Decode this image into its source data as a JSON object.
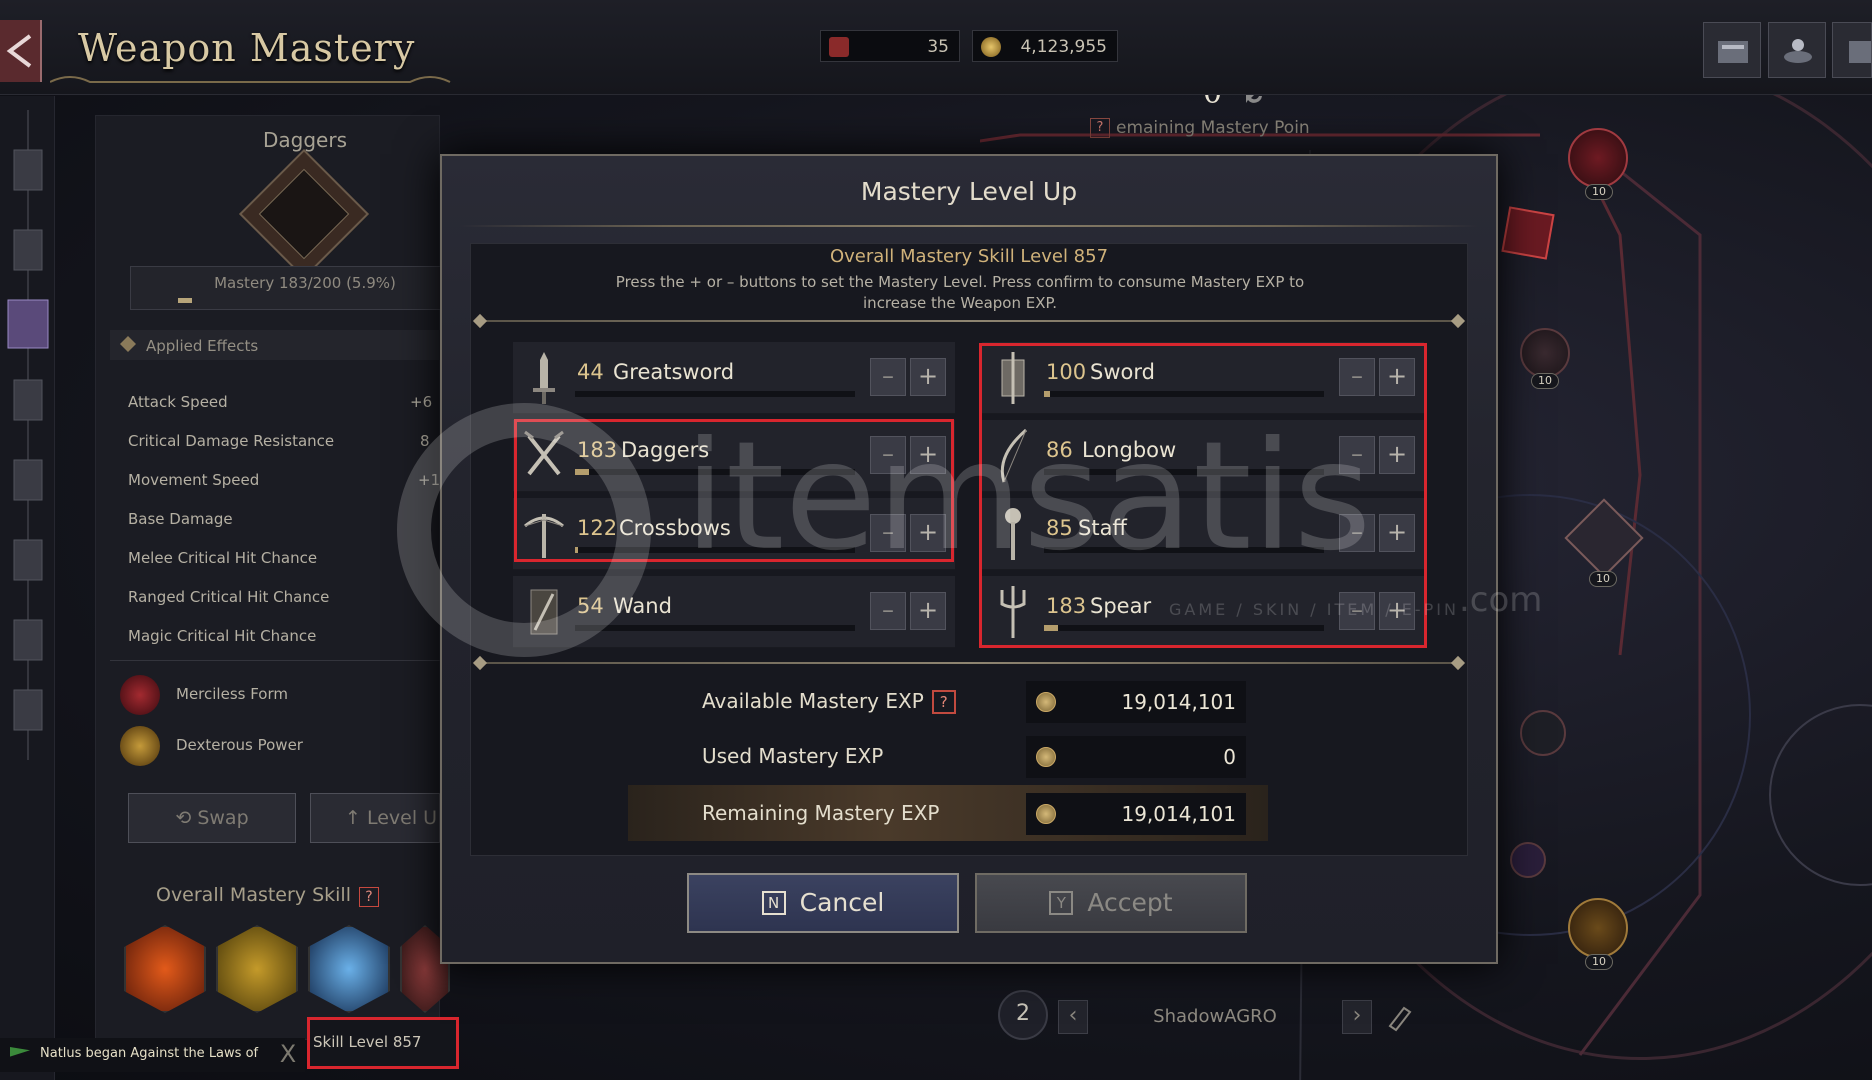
{
  "header": {
    "title": "Weapon Mastery",
    "currency": [
      {
        "icon": "ticket-icon",
        "value": "35"
      },
      {
        "icon": "gold-coin-icon",
        "value": "4,123,955"
      }
    ],
    "top_buttons": [
      "codex-icon",
      "altar-icon",
      "scroll-icon"
    ]
  },
  "left_panel": {
    "weapon_name": "Daggers",
    "mastery_text": "Mastery 183/200 (5.9%)",
    "mastery_progress": 0.059,
    "applied_effects_label": "Applied Effects",
    "stats": [
      {
        "label": "Attack Speed",
        "value": "+6"
      },
      {
        "label": "Critical Damage Resistance",
        "value": "8"
      },
      {
        "label": "Movement Speed",
        "value": "+1"
      },
      {
        "label": "Base Damage",
        "value": ""
      },
      {
        "label": "Melee Critical Hit Chance",
        "value": ""
      },
      {
        "label": "Ranged Critical Hit Chance",
        "value": ""
      },
      {
        "label": "Magic Critical Hit Chance",
        "value": ""
      }
    ],
    "effects": [
      {
        "label": "Merciless Form",
        "icon": "merciless-form-icon"
      },
      {
        "label": "Dexterous Power",
        "icon": "dexterous-power-icon"
      }
    ],
    "swap_label": "Swap",
    "levelup_label": "Level U",
    "overall_skill_label": "Overall Mastery Skill",
    "overall_skill_help": "?",
    "skill_level_text": "Skill Level 857"
  },
  "chat": {
    "message": "Natlus began Against the Laws of",
    "close": "X"
  },
  "tree": {
    "remaining_points": "0",
    "remaining_label": "emaining Mastery Poin",
    "remaining_help": "?",
    "node_levels": [
      "10",
      "10",
      "10",
      "10"
    ]
  },
  "bottom_nav": {
    "slot": "2",
    "character_name": "ShadowAGRO"
  },
  "modal": {
    "title": "Mastery Level Up",
    "overall_line": "Overall Mastery Skill Level 857",
    "instruction": "Press the + or – buttons to set the Mastery Level. Press confirm to consume Mastery EXP to increase the Weapon EXP.",
    "weapons_left": [
      {
        "level": "44",
        "name": "Greatsword",
        "progress": 0.0,
        "icon": "greatsword-icon"
      },
      {
        "level": "183",
        "name": "Daggers",
        "progress": 0.05,
        "icon": "daggers-icon"
      },
      {
        "level": "122",
        "name": "Crossbows",
        "progress": 0.005,
        "icon": "crossbow-icon"
      },
      {
        "level": "54",
        "name": "Wand",
        "progress": 0.0,
        "icon": "wand-icon"
      }
    ],
    "weapons_right": [
      {
        "level": "100",
        "name": "Sword",
        "progress": 0.02,
        "icon": "sword-icon"
      },
      {
        "level": "86",
        "name": "Longbow",
        "progress": 0.0,
        "icon": "longbow-icon"
      },
      {
        "level": "85",
        "name": "Staff",
        "progress": 0.0,
        "icon": "staff-icon"
      },
      {
        "level": "183",
        "name": "Spear",
        "progress": 0.05,
        "icon": "spear-icon"
      }
    ],
    "minus": "–",
    "plus": "+",
    "exp": [
      {
        "label": "Available Mastery EXP",
        "value": "19,014,101",
        "help": "?"
      },
      {
        "label": "Used Mastery EXP",
        "value": "0"
      },
      {
        "label": "Remaining Mastery EXP",
        "value": "19,014,101"
      }
    ],
    "cancel": {
      "key": "N",
      "label": "Cancel"
    },
    "accept": {
      "key": "Y",
      "label": "Accept"
    }
  },
  "watermark": {
    "brand": "itemsatis",
    "tagline": "GAME / SKIN / ITEM / E-PIN",
    "domain": ".com"
  },
  "colors": {
    "highlight_red": "#d9262e",
    "gold_text": "#dcc48e",
    "cancel_blue": "#3b4260"
  }
}
